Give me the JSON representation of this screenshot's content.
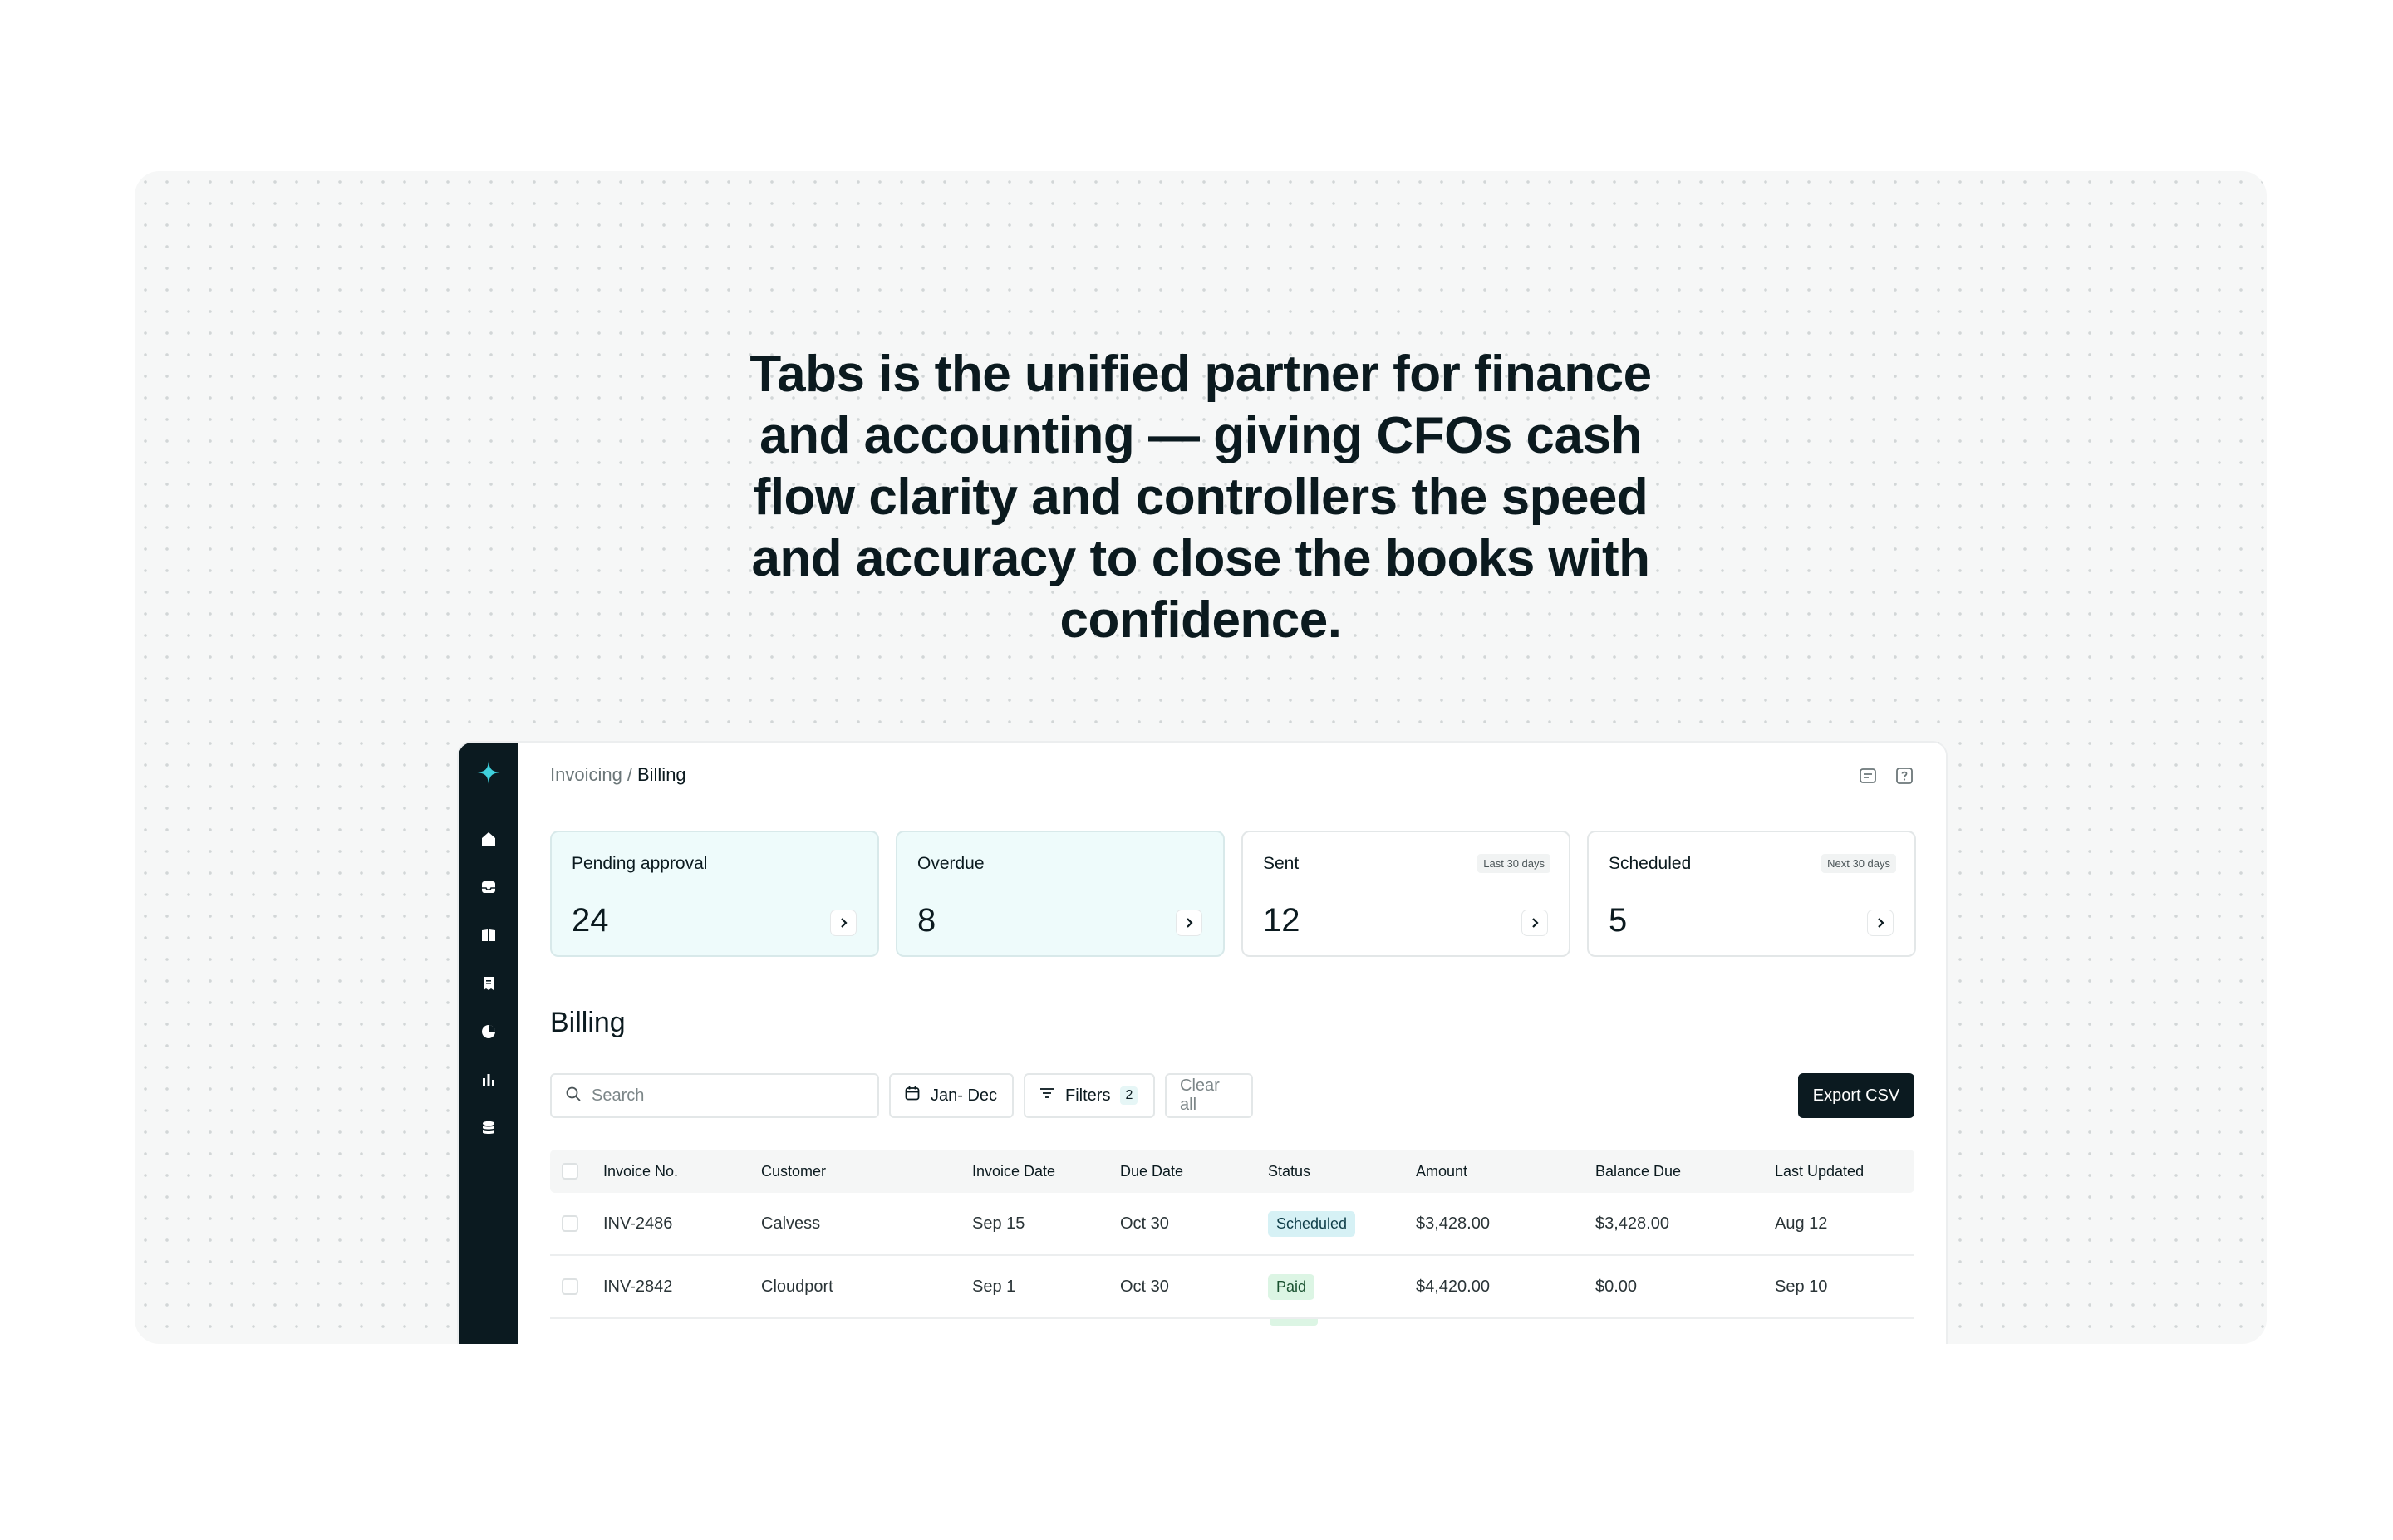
{
  "headline": "Tabs is the unified partner for finance and accounting — giving CFOs cash flow clarity and controllers the speed and accuracy to close the books with confidence.",
  "colors": {
    "sidebar": "#0b1a20",
    "accent": "#3fd0dc",
    "tinted_card": "#eefbfb",
    "scheduled_pill": "#d6f1f5",
    "paid_pill": "#dcf5e4",
    "export_button": "#0b1a20"
  },
  "sidebar": {
    "logo_icon": "sparkle-icon",
    "items": [
      "home-icon",
      "inbox-icon",
      "book-icon",
      "receipt-icon",
      "pie-chart-icon",
      "bar-chart-icon",
      "database-icon"
    ]
  },
  "breadcrumb": {
    "parent": "Invoicing",
    "separator": "/",
    "current": "Billing"
  },
  "top_icons": [
    "sidebar-toggle-icon",
    "help-icon"
  ],
  "stats": [
    {
      "label": "Pending approval",
      "value": "24",
      "badge": ""
    },
    {
      "label": "Overdue",
      "value": "8",
      "badge": ""
    },
    {
      "label": "Sent",
      "value": "12",
      "badge": "Last 30 days"
    },
    {
      "label": "Scheduled",
      "value": "5",
      "badge": "Next 30 days"
    }
  ],
  "section_title": "Billing",
  "toolbar": {
    "search_placeholder": "Search",
    "date_range": "Jan- Dec",
    "filters_label": "Filters",
    "filters_count": "2",
    "clear_label": "Clear all",
    "export_label": "Export CSV"
  },
  "table": {
    "columns": [
      "Invoice No.",
      "Customer",
      "Invoice Date",
      "Due Date",
      "Status",
      "Amount",
      "Balance Due",
      "Last Updated"
    ],
    "rows": [
      {
        "invoice": "INV-2486",
        "customer": "Calvess",
        "invoice_date": "Sep 15",
        "due_date": "Oct 30",
        "status": "Scheduled",
        "amount": "$3,428.00",
        "balance": "$3,428.00",
        "updated": "Aug 12"
      },
      {
        "invoice": "INV-2842",
        "customer": "Cloudport",
        "invoice_date": "Sep 1",
        "due_date": "Oct 30",
        "status": "Paid",
        "amount": "$4,420.00",
        "balance": "$0.00",
        "updated": "Sep 10"
      }
    ]
  }
}
